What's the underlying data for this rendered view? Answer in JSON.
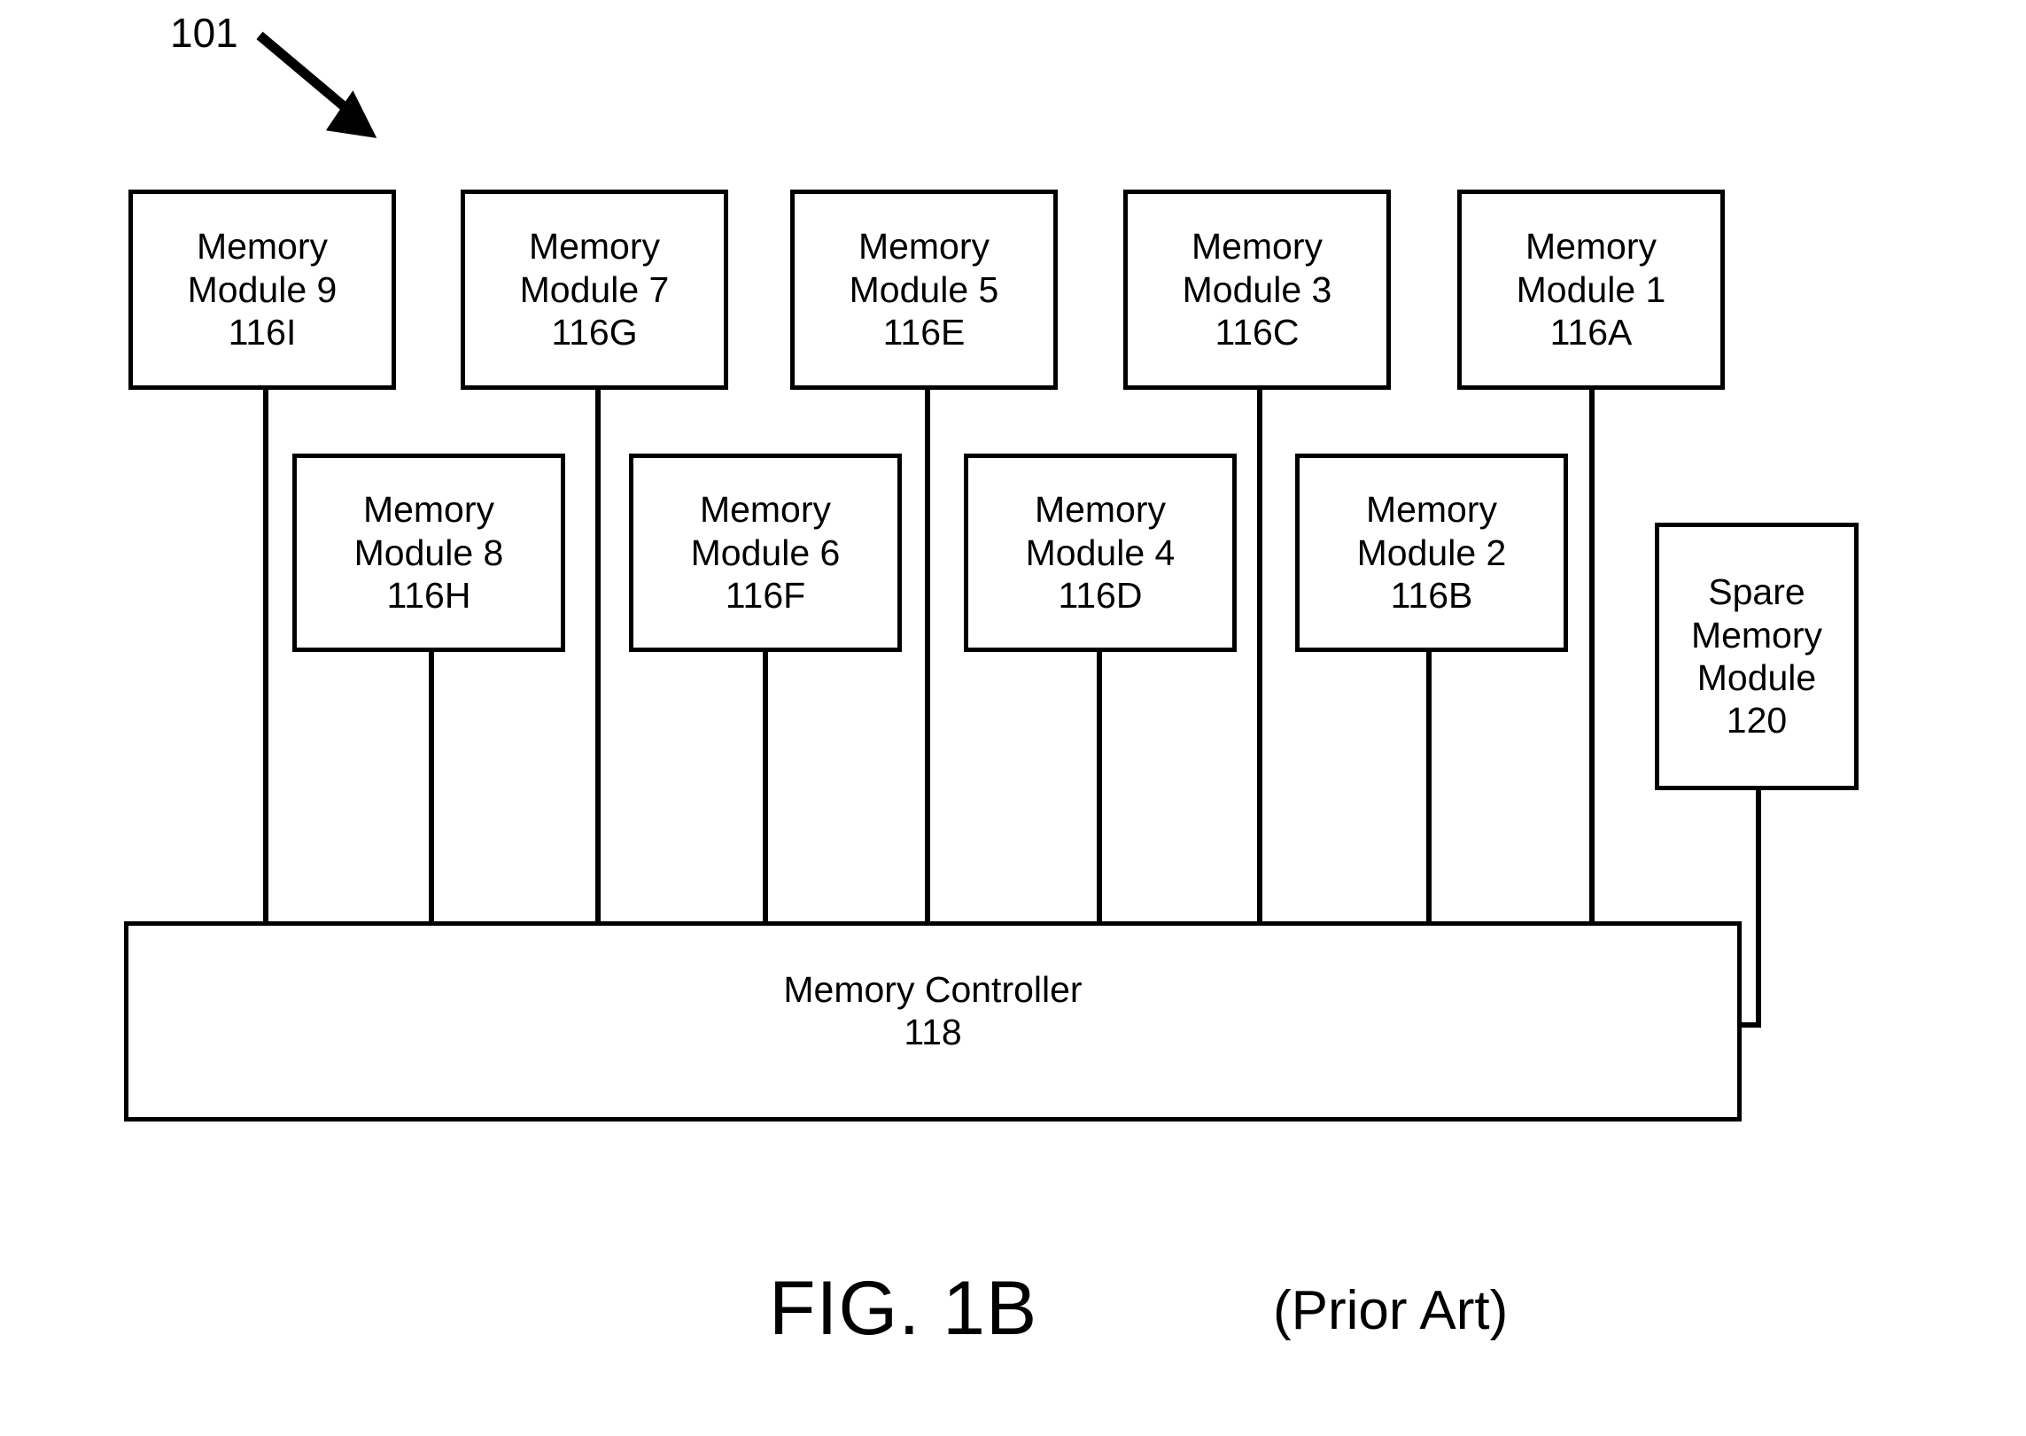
{
  "figure": {
    "reference_numeral": "101",
    "caption": "FIG. 1B",
    "caption_note": "(Prior Art)",
    "line_color": "#000000",
    "background_color": "#ffffff"
  },
  "top_row_modules": [
    {
      "name_line1": "Memory",
      "name_line2": "Module 9",
      "ref": "116I"
    },
    {
      "name_line1": "Memory",
      "name_line2": "Module 7",
      "ref": "116G"
    },
    {
      "name_line1": "Memory",
      "name_line2": "Module 5",
      "ref": "116E"
    },
    {
      "name_line1": "Memory",
      "name_line2": "Module 3",
      "ref": "116C"
    },
    {
      "name_line1": "Memory",
      "name_line2": "Module 1",
      "ref": "116A"
    }
  ],
  "second_row_modules": [
    {
      "name_line1": "Memory",
      "name_line2": "Module 8",
      "ref": "116H"
    },
    {
      "name_line1": "Memory",
      "name_line2": "Module 6",
      "ref": "116F"
    },
    {
      "name_line1": "Memory",
      "name_line2": "Module 4",
      "ref": "116D"
    },
    {
      "name_line1": "Memory",
      "name_line2": "Module 2",
      "ref": "116B"
    }
  ],
  "spare_module": {
    "name_line1": "Spare",
    "name_line2": "Memory",
    "name_line3": "Module",
    "ref": "120"
  },
  "controller": {
    "name": "Memory Controller",
    "ref": "118"
  }
}
